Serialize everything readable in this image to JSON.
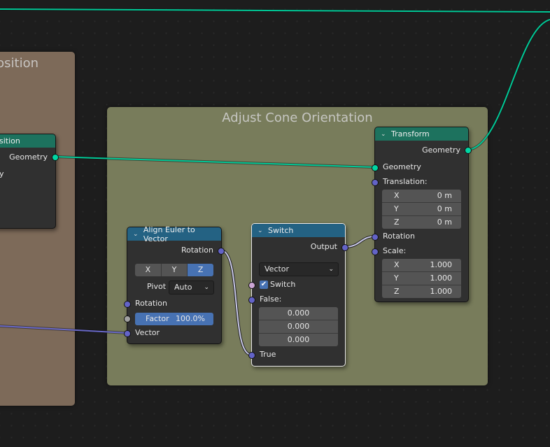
{
  "frames": {
    "left": {
      "title": "osition"
    },
    "adjust": {
      "title": "Adjust Cone Orientation"
    }
  },
  "colors": {
    "geometry_socket": "#00d6a3",
    "vector_socket": "#6363c7",
    "boolean_socket": "#cca6d6",
    "float_socket": "#a1a1a1",
    "geometry_header": "#1d725e",
    "vector_header": "#246283",
    "accent_blue": "#4772b3"
  },
  "nodes": {
    "set_position": {
      "title": "sition",
      "outputs": {
        "geometry": "Geometry"
      },
      "inputs": {
        "partial": "y"
      }
    },
    "align_euler": {
      "title": "Align Euler to Vector",
      "outputs": {
        "rotation": "Rotation"
      },
      "axis_buttons": [
        "X",
        "Y",
        "Z"
      ],
      "axis_selected": "Z",
      "pivot_label": "Pivot",
      "pivot_value": "Auto",
      "inputs": {
        "rotation": "Rotation",
        "vector": "Vector"
      },
      "factor_label": "Factor",
      "factor_value": "100.0%"
    },
    "switch": {
      "title": "Switch",
      "outputs": {
        "output": "Output"
      },
      "type_value": "Vector",
      "switch_label": "Switch",
      "switch_checked": true,
      "false_label": "False:",
      "false_values": [
        "0.000",
        "0.000",
        "0.000"
      ],
      "true_label": "True"
    },
    "transform": {
      "title": "Transform",
      "outputs": {
        "geometry": "Geometry"
      },
      "inputs": {
        "geometry": "Geometry",
        "translation": "Translation:",
        "rotation": "Rotation",
        "scale": "Scale:"
      },
      "translation": [
        {
          "axis": "X",
          "value": "0 m"
        },
        {
          "axis": "Y",
          "value": "0 m"
        },
        {
          "axis": "Z",
          "value": "0 m"
        }
      ],
      "scale": [
        {
          "axis": "X",
          "value": "1.000"
        },
        {
          "axis": "Y",
          "value": "1.000"
        },
        {
          "axis": "Z",
          "value": "1.000"
        }
      ]
    }
  },
  "icons": {
    "chevron": "⌄",
    "dropdown": "⌄",
    "check": "✔"
  }
}
